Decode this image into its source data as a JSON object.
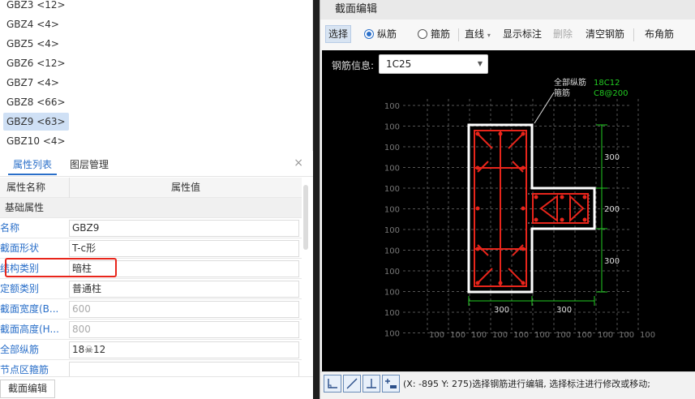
{
  "component_list": {
    "items": [
      {
        "name": "GBZ3",
        "count": "<12>"
      },
      {
        "name": "GBZ4",
        "count": "<4>"
      },
      {
        "name": "GBZ5",
        "count": "<4>"
      },
      {
        "name": "GBZ6",
        "count": "<12>"
      },
      {
        "name": "GBZ7",
        "count": "<4>"
      },
      {
        "name": "GBZ8",
        "count": "<66>"
      },
      {
        "name": "GBZ9",
        "count": "<63>",
        "selected": true
      },
      {
        "name": "GBZ10",
        "count": "<4>"
      }
    ]
  },
  "tabs": {
    "properties": "属性列表",
    "layers": "图层管理",
    "close": "×"
  },
  "property_table": {
    "header_name": "属性名称",
    "header_value": "属性值",
    "group": "基础属性",
    "rows": [
      {
        "name": "名称",
        "value": "GBZ9",
        "disabled": false
      },
      {
        "name": "截面形状",
        "value": "T-c形",
        "disabled": false
      },
      {
        "name": "结构类别",
        "value": "暗柱",
        "disabled": false
      },
      {
        "name": "定额类别",
        "value": "普通柱",
        "disabled": false
      },
      {
        "name": "截面宽度(B...",
        "value": "600",
        "disabled": true
      },
      {
        "name": "截面高度(H...",
        "value": "800",
        "disabled": true
      },
      {
        "name": "全部纵筋",
        "value": "18☠12",
        "disabled": false
      },
      {
        "name": "节点区箍筋",
        "value": "",
        "disabled": false
      }
    ]
  },
  "bottom": {
    "section_edit_button": "截面编辑"
  },
  "dialog": {
    "title": "截面编辑",
    "toolbar": {
      "select": "选择",
      "longitudinal": "纵筋",
      "stirrup": "箍筋",
      "line": "直线",
      "show_dims": "显示标注",
      "delete": "删除",
      "clear_rebar": "清空钢筋",
      "corner_rebar": "布角筋"
    },
    "rebar_info_label": "钢筋信息:",
    "rebar_info_value": "1C25",
    "annotation": {
      "all_long_label": "全部纵筋",
      "all_long_value": "18C12",
      "stirrup_label": "箍筋",
      "stirrup_value": "C8@200"
    },
    "dims": {
      "right": [
        "300",
        "200",
        "300"
      ],
      "bottom": [
        "300",
        "300"
      ],
      "grid_label": "100"
    },
    "status_text": "(X: -895 Y: 275)选择钢筋进行编辑, 选择标注进行修改或移动;"
  },
  "colors": {
    "rebar": "#e8251b",
    "dim": "#22cc22",
    "outline": "#ffffff",
    "accent": "#2a6fc9"
  }
}
